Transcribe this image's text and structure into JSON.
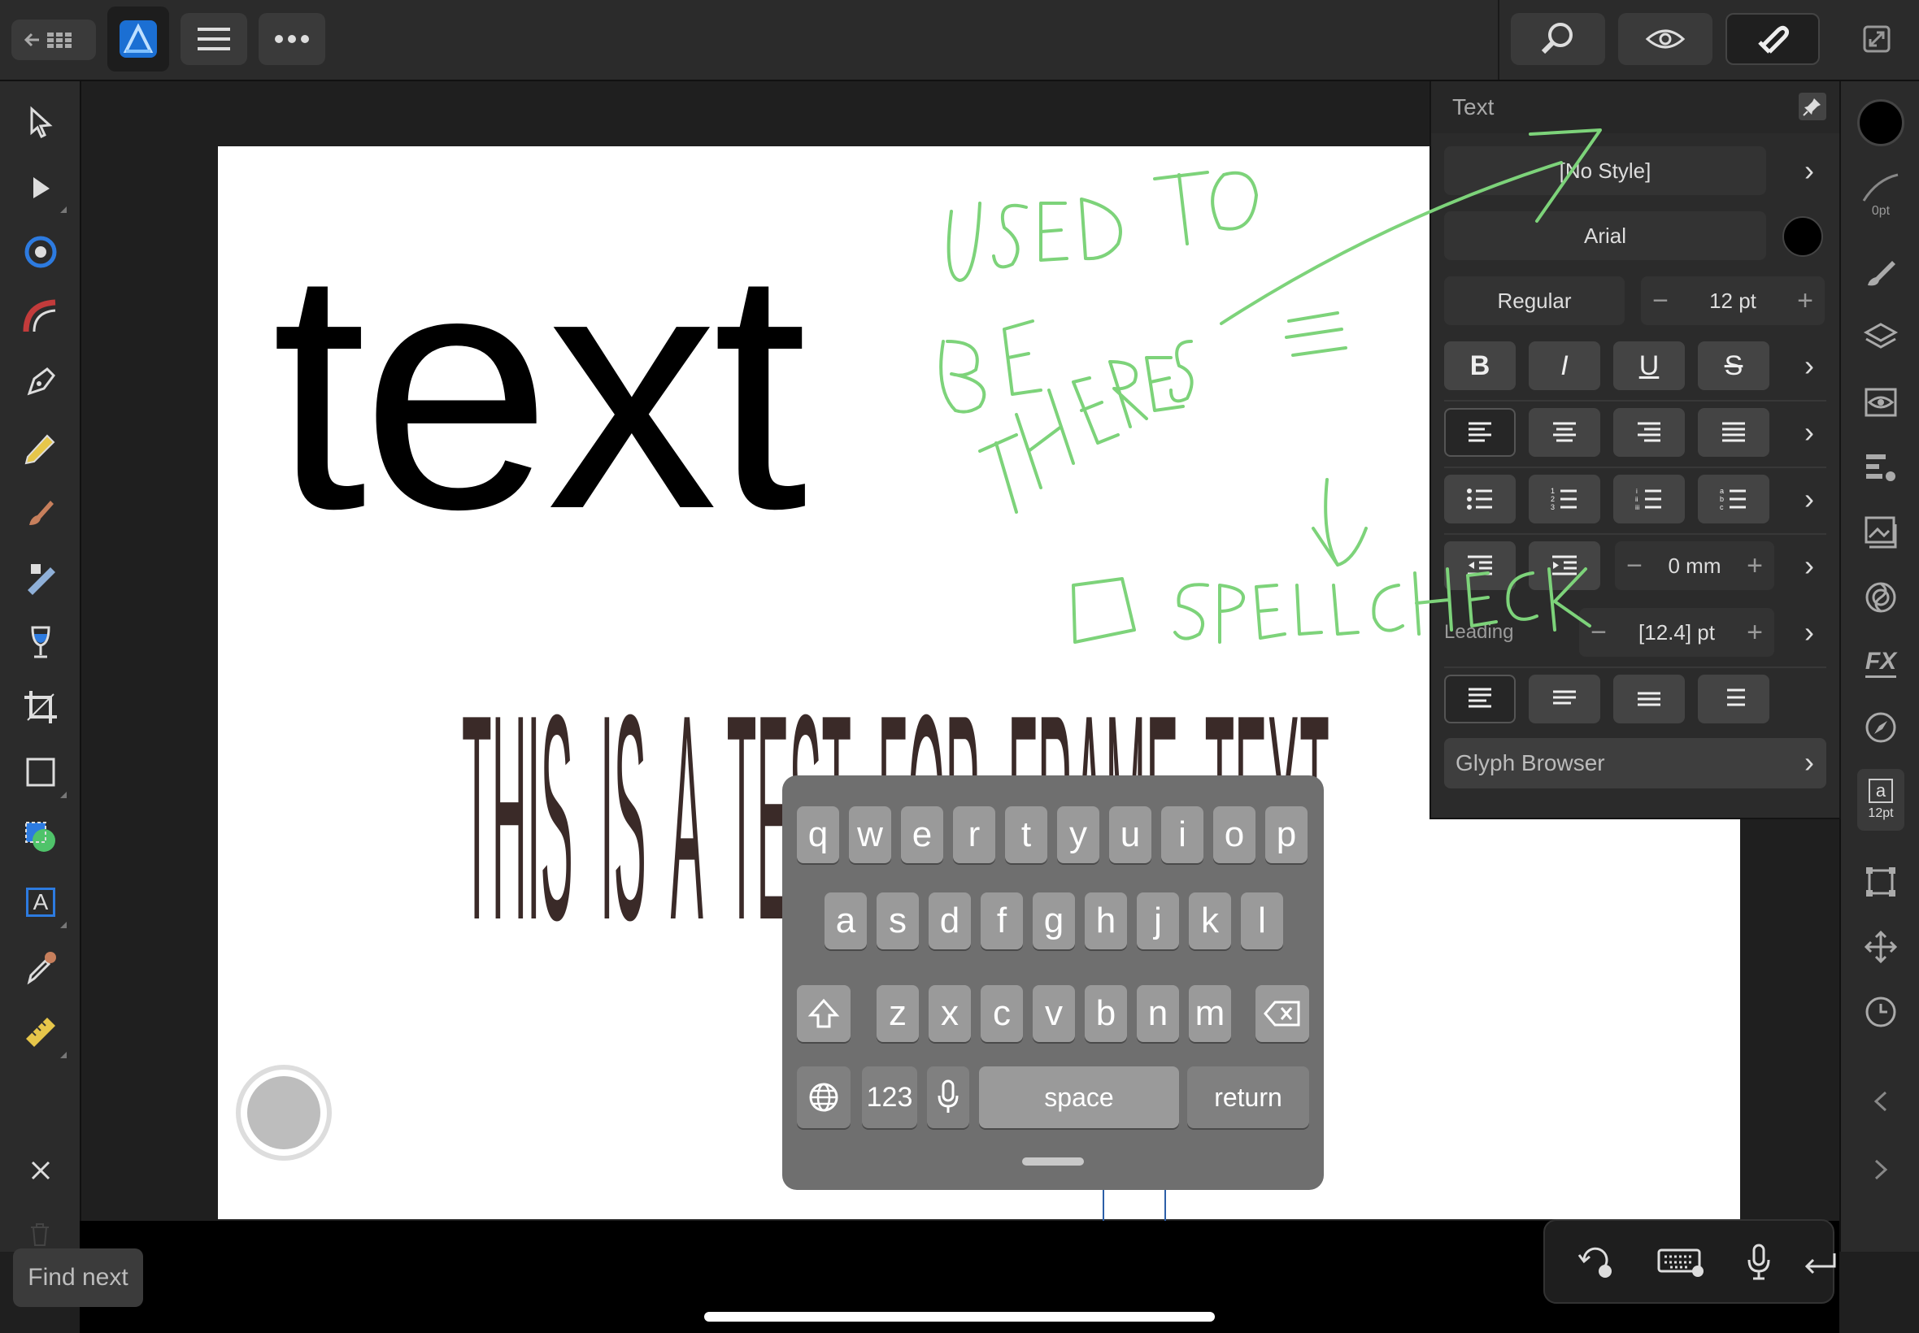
{
  "panel": {
    "title": "Text",
    "style": "[No Style]",
    "font": "Arial",
    "weight": "Regular",
    "size": "12 pt",
    "indent": "0 mm",
    "leading_label": "Leading",
    "leading": "[12.4] pt",
    "glyph_browser": "Glyph Browser",
    "bold": "B",
    "italic": "I",
    "underline": "U",
    "strike": "S",
    "minus": "−",
    "plus": "+"
  },
  "right_toolbar": {
    "stroke_width": "0pt",
    "text_size": "12pt",
    "text_icon_letter": "a"
  },
  "canvas": {
    "big_text": "text",
    "frame_text": "THIS  IS  A  TEST  FOR  FRAME  TEXT"
  },
  "bottom": {
    "find_next": "Find next"
  },
  "keyboard": {
    "row1": [
      "q",
      "w",
      "e",
      "r",
      "t",
      "y",
      "u",
      "i",
      "o",
      "p"
    ],
    "row2": [
      "a",
      "s",
      "d",
      "f",
      "g",
      "h",
      "j",
      "k",
      "l"
    ],
    "row3": [
      "z",
      "x",
      "c",
      "v",
      "b",
      "n",
      "m"
    ],
    "numbers": "123",
    "space": "space",
    "return": "return"
  },
  "left_toolbar": {
    "text_tool_letter": "A"
  },
  "colors": {
    "annotation": "#7dd37a",
    "accent": "#2d7be0",
    "frame_text": "#3a2a28"
  }
}
